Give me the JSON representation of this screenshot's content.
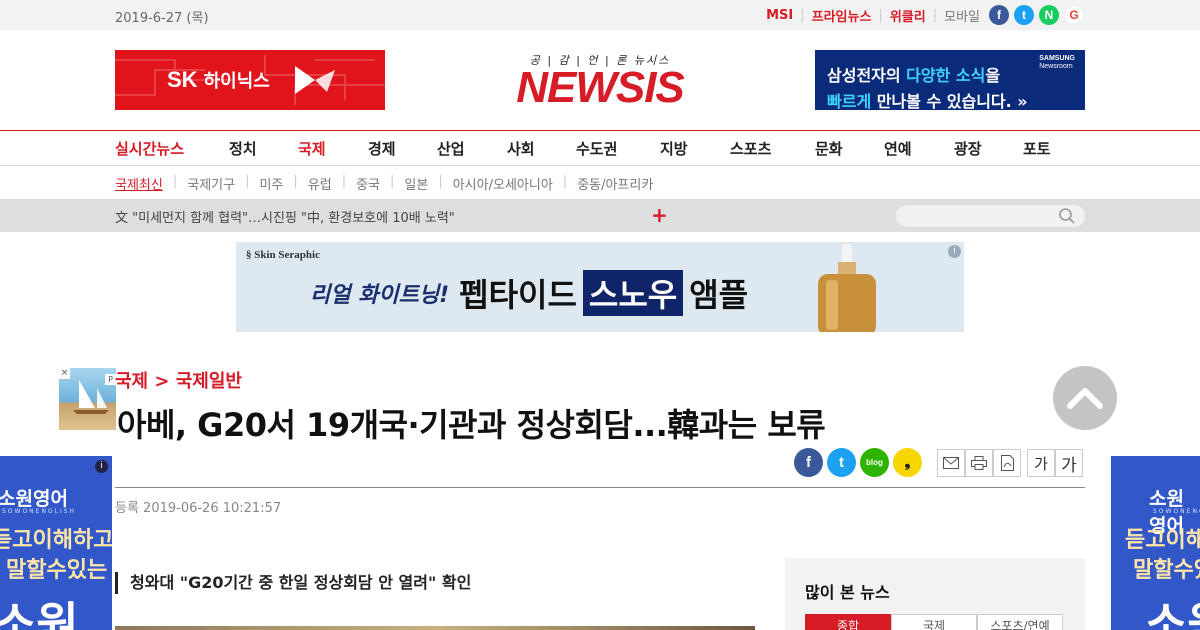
{
  "topbar": {
    "date": "2019-6-27 (목)",
    "links": [
      "MSI",
      "프라임뉴스",
      "위클리",
      "모바일"
    ],
    "social": [
      {
        "name": "facebook-icon",
        "glyph": "f",
        "color": "#3b5998"
      },
      {
        "name": "twitter-icon",
        "glyph": "t",
        "color": "#1da1f2"
      },
      {
        "name": "naver-icon",
        "glyph": "N",
        "color": "#19ce60"
      },
      {
        "name": "google-icon",
        "glyph": "G",
        "color": "#ea4335"
      }
    ]
  },
  "header": {
    "left_banner": {
      "brand": "SK",
      "name": "하이닉스"
    },
    "logo": {
      "tagline": "공 | 감 | 언 | 론  뉴시스",
      "name": "NEWSIS"
    },
    "right_banner": {
      "line1_a": "삼성전자의 ",
      "line1_b": "다양한 소식",
      "line1_c": "을",
      "line2_a": "빠르게",
      "line2_b": " 만나볼 수 있습니다. »",
      "badge_1": "SAMSUNG",
      "badge_2": "Newsroom"
    }
  },
  "nav": [
    "실시간뉴스",
    "정치",
    "국제",
    "경제",
    "산업",
    "사회",
    "수도권",
    "지방",
    "스포츠",
    "문화",
    "연예",
    "광장",
    "포토"
  ],
  "subnav": [
    "국제최신",
    "국제기구",
    "미주",
    "유럽",
    "중국",
    "일본",
    "아시아/오세아니아",
    "중동/아프리카"
  ],
  "ticker": {
    "text": "文 \"미세먼지 함께 협력\"…시진핑 \"中, 환경보호에 10배 노력\"",
    "plus": "+"
  },
  "search": {
    "placeholder": ""
  },
  "ad": {
    "brand": "§ Skin Seraphic",
    "copy1": "리얼 화이트닝!",
    "copy2": "펩타이드",
    "copy3": "스노우",
    "copy4": "앰플",
    "info": "i"
  },
  "article": {
    "category": "국제 > 국제일반",
    "headline": "아베, G20서 19개국·기관과 정상회담...韓과는 보류",
    "registered": "등록 2019-06-26 10:21:57",
    "subheadline": "청와대 \"G20기간 중 한일 정상회담 안 열려\" 확인"
  },
  "share": [
    {
      "name": "facebook-share-icon",
      "glyph": "f",
      "color": "#3b5998"
    },
    {
      "name": "twitter-share-icon",
      "glyph": "t",
      "color": "#1da1f2"
    },
    {
      "name": "blog-share-icon",
      "glyph": "blog",
      "color": "#2db400"
    },
    {
      "name": "kakao-share-icon",
      "glyph": "❟",
      "color": "#f7d600"
    }
  ],
  "tools": {
    "font_small": "가",
    "font_large": "가"
  },
  "side_ad": {
    "brand": "소원영어",
    "sub": "SOWONENGLISH",
    "line1": "듣고이해하고",
    "line2": "말할수있는",
    "line3": "소원",
    "info": "i"
  },
  "popular": {
    "title": "많이 본 뉴스",
    "tabs": [
      "종합",
      "국제",
      "스포츠/연예"
    ]
  }
}
